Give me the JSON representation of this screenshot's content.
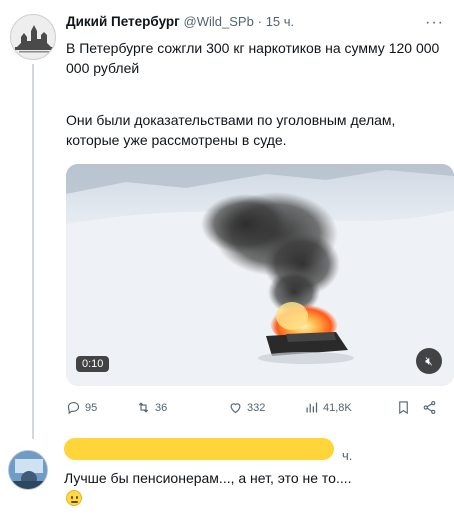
{
  "tweet": {
    "author_name": "Дикий Петербург",
    "handle": "@Wild_SPb",
    "separator": "·",
    "time": "15 ч.",
    "more": "···",
    "text_line1": "В Петербурге сожгли 300 кг наркотиков на сумму 120 000 000 рублей",
    "text_line2": "Они были доказательствами по уголовным делам, которые уже рассмотрены в суде.",
    "video": {
      "duration": "0:10",
      "mute_icon": "speaker-muted-icon"
    },
    "actions": {
      "replies": "95",
      "retweets": "36",
      "likes": "332",
      "views": "41,8K"
    }
  },
  "reply": {
    "time_suffix": "ч.",
    "text": "Лучше бы пенсионерам..., а нет, это не то....",
    "emoji": "slightly-smiling-face-icon",
    "colors": {
      "redaction": "#ffd53a"
    }
  }
}
